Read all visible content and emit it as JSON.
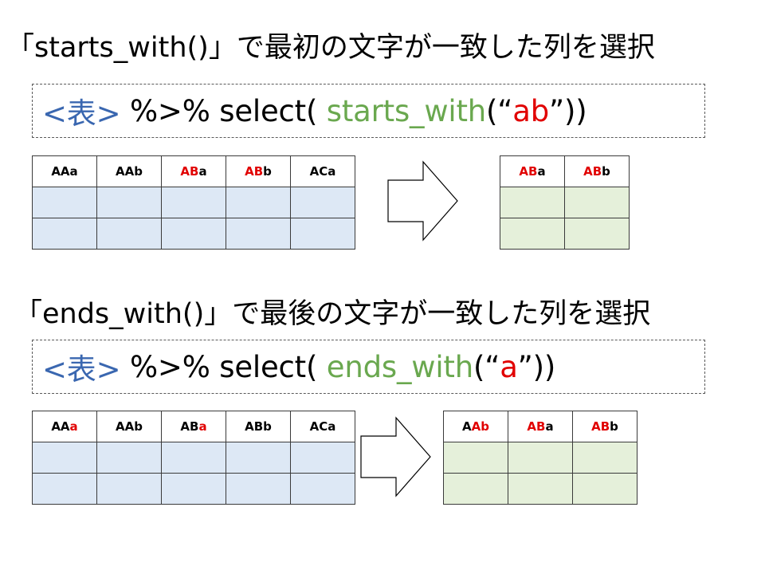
{
  "section1": {
    "heading": "「starts_with()」で最初の文字が一致した列を選択",
    "code": {
      "table_token": "<表>",
      "pipe": " %>% select( ",
      "func": "starts_with",
      "open": "(“",
      "arg": "ab",
      "close": "”))"
    },
    "source_columns": [
      {
        "hl": "",
        "rest": "AAa"
      },
      {
        "hl": "",
        "rest": "AAb"
      },
      {
        "hl": "AB",
        "rest": "a"
      },
      {
        "hl": "AB",
        "rest": "b"
      },
      {
        "hl": "",
        "rest": "ACa"
      }
    ],
    "result_columns": [
      {
        "hl": "AB",
        "rest": "a"
      },
      {
        "hl": "AB",
        "rest": "b"
      }
    ]
  },
  "section2": {
    "heading": "「ends_with()」で最後の文字が一致した列を選択",
    "code": {
      "table_token": "<表>",
      "pipe": " %>% select( ",
      "func": "ends_with",
      "open": "(“",
      "arg": "a",
      "close": "”))"
    },
    "source_columns": [
      {
        "pre": "AA",
        "hl": "a"
      },
      {
        "pre": "AAb",
        "hl": ""
      },
      {
        "pre": "AB",
        "hl": "a"
      },
      {
        "pre": "ABb",
        "hl": ""
      },
      {
        "pre": "ACa",
        "hl": ""
      }
    ],
    "result_columns": [
      {
        "pre": "A",
        "hl": "Ab"
      },
      {
        "pre": "",
        "hl": "AB",
        "post": "a"
      },
      {
        "pre": "",
        "hl": "AB",
        "post": "b"
      }
    ]
  },
  "colors": {
    "table_token": "#3a67b0",
    "function": "#6aa84f",
    "highlight": "#e10000",
    "source_fill": "#dde8f5",
    "result_fill": "#e5f0da"
  }
}
